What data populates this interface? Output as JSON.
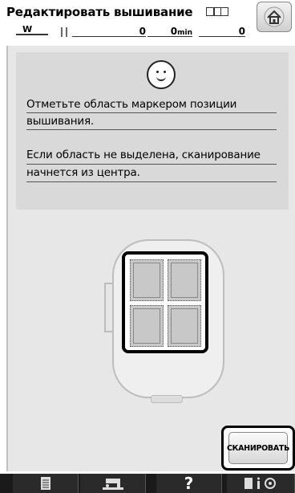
{
  "header": {
    "title": "Редактировать вышивание",
    "w_label": "W",
    "counter1": "0",
    "counter2": "0",
    "counter2_unit": "min",
    "counter3": "0"
  },
  "message": {
    "line1": "Отметьте область маркером позиции",
    "line2": "вышивания.",
    "line3": "Если область не выделена, сканирование",
    "line4": "начнется из центра."
  },
  "scan_button": {
    "label": "СКАНИРОВАТЬ"
  },
  "toolbar": {
    "help_label": "?"
  },
  "icons": [
    "home-icon",
    "smiley-icon",
    "hoop-icon",
    "document-icon",
    "sewing-machine-icon",
    "help-icon",
    "settings-icon"
  ]
}
